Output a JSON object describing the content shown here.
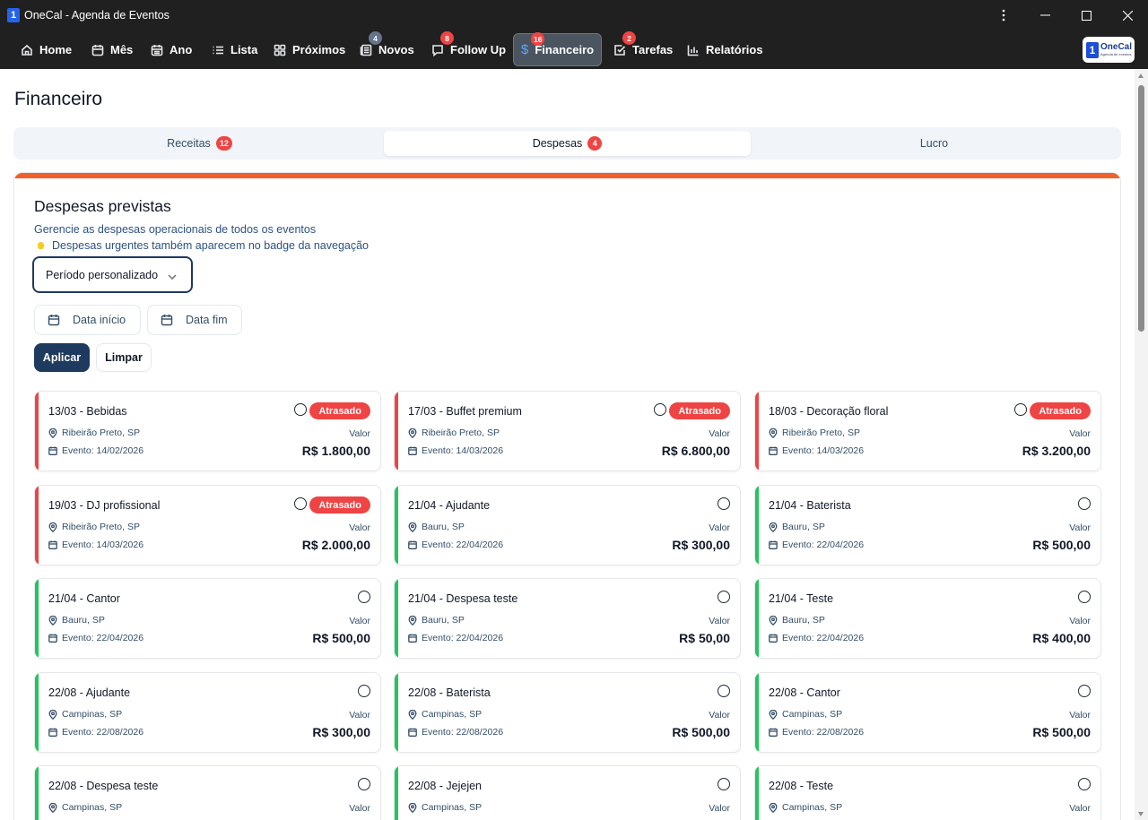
{
  "window": {
    "title": "OneCal - Agenda de Eventos",
    "logo_glyph": "1"
  },
  "nav": {
    "items": [
      {
        "label": "Home",
        "icon": "home-icon"
      },
      {
        "label": "Mês",
        "icon": "calendar-icon"
      },
      {
        "label": "Ano",
        "icon": "calendar-grid-icon"
      },
      {
        "label": "Lista",
        "icon": "list-icon"
      },
      {
        "label": "Próximos",
        "icon": "layout-grid-icon"
      },
      {
        "label": "Novos",
        "icon": "newspaper-icon",
        "badge": "4"
      },
      {
        "label": "Follow Up",
        "icon": "message-icon",
        "badge": "8"
      },
      {
        "label": "Financeiro",
        "icon": "dollar-icon",
        "badge": "16",
        "active": true
      },
      {
        "label": "Tarefas",
        "icon": "check-square-icon",
        "badge": "2"
      },
      {
        "label": "Relatórios",
        "icon": "bar-chart-icon"
      }
    ],
    "brand": {
      "mark": "1",
      "name": "OneCal",
      "tagline": "Agenda de eventos"
    }
  },
  "page": {
    "title": "Financeiro",
    "tabs": [
      {
        "label": "Receitas",
        "badge": "12"
      },
      {
        "label": "Despesas",
        "badge": "4",
        "active": true
      },
      {
        "label": "Lucro"
      }
    ]
  },
  "panel": {
    "title": "Despesas previstas",
    "description": "Gerencie as despesas operacionais de todos os eventos",
    "hint": "Despesas urgentes também aparecem no badge da navegação",
    "period_select": "Período personalizado",
    "date_start_placeholder": "Data início",
    "date_end_placeholder": "Data fim",
    "apply_label": "Aplicar",
    "clear_label": "Limpar",
    "value_label": "Valor"
  },
  "colors": {
    "accent": "#f0602b",
    "overdue": "#ef4444",
    "ok": "#22c55e",
    "primary": "#1e3a5f"
  },
  "expenses": [
    {
      "title": "13/03 - Bebidas",
      "location": "Ribeirão Preto, SP",
      "event": "Evento: 14/02/2026",
      "value": "R$ 1.800,00",
      "status": "Atrasado"
    },
    {
      "title": "17/03 - Buffet premium",
      "location": "Ribeirão Preto, SP",
      "event": "Evento: 14/03/2026",
      "value": "R$ 6.800,00",
      "status": "Atrasado"
    },
    {
      "title": "18/03 - Decoração floral",
      "location": "Ribeirão Preto, SP",
      "event": "Evento: 14/03/2026",
      "value": "R$ 3.200,00",
      "status": "Atrasado"
    },
    {
      "title": "19/03 - DJ profissional",
      "location": "Ribeirão Preto, SP",
      "event": "Evento: 14/03/2026",
      "value": "R$ 2.000,00",
      "status": "Atrasado"
    },
    {
      "title": "21/04 - Ajudante",
      "location": "Bauru, SP",
      "event": "Evento: 22/04/2026",
      "value": "R$ 300,00",
      "status": ""
    },
    {
      "title": "21/04 - Baterista",
      "location": "Bauru, SP",
      "event": "Evento: 22/04/2026",
      "value": "R$ 500,00",
      "status": ""
    },
    {
      "title": "21/04 - Cantor",
      "location": "Bauru, SP",
      "event": "Evento: 22/04/2026",
      "value": "R$ 500,00",
      "status": ""
    },
    {
      "title": "21/04 - Despesa teste",
      "location": "Bauru, SP",
      "event": "Evento: 22/04/2026",
      "value": "R$ 50,00",
      "status": ""
    },
    {
      "title": "21/04 - Teste",
      "location": "Bauru, SP",
      "event": "Evento: 22/04/2026",
      "value": "R$ 400,00",
      "status": ""
    },
    {
      "title": "22/08 - Ajudante",
      "location": "Campinas, SP",
      "event": "Evento: 22/08/2026",
      "value": "R$ 300,00",
      "status": ""
    },
    {
      "title": "22/08 - Baterista",
      "location": "Campinas, SP",
      "event": "Evento: 22/08/2026",
      "value": "R$ 500,00",
      "status": ""
    },
    {
      "title": "22/08 - Cantor",
      "location": "Campinas, SP",
      "event": "Evento: 22/08/2026",
      "value": "R$ 500,00",
      "status": ""
    },
    {
      "title": "22/08 - Despesa teste",
      "location": "Campinas, SP",
      "event": "",
      "value": "",
      "status": ""
    },
    {
      "title": "22/08 - Jejejen",
      "location": "Campinas, SP",
      "event": "",
      "value": "",
      "status": ""
    },
    {
      "title": "22/08 - Teste",
      "location": "Campinas, SP",
      "event": "",
      "value": "",
      "status": ""
    }
  ]
}
